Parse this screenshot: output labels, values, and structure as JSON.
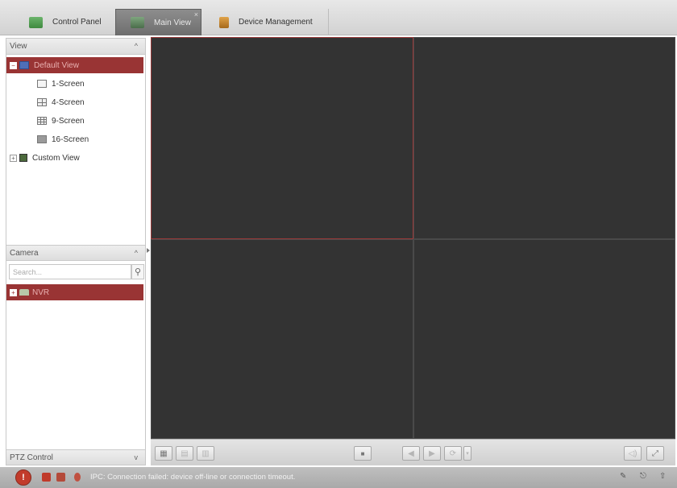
{
  "tabs": [
    {
      "label": "Control Panel",
      "active": false
    },
    {
      "label": "Main View",
      "active": true,
      "close": "×"
    },
    {
      "label": "Device Management",
      "active": false
    }
  ],
  "view_panel": {
    "header": "View",
    "collapse_glyph": "^",
    "default_view": "Default View",
    "screens": [
      "1-Screen",
      "4-Screen",
      "9-Screen",
      "16-Screen"
    ],
    "custom_view": "Custom View"
  },
  "camera_panel": {
    "header": "Camera",
    "collapse_glyph": "^",
    "search_placeholder": "Search...",
    "search_icon": "⚲",
    "nvr_label": "NVR"
  },
  "ptz_panel": {
    "header": "PTZ Control",
    "expand_glyph": "v"
  },
  "video_grid": {
    "rows": 2,
    "cols": 2,
    "active_cell": 0,
    "background_color": "#333333",
    "active_border_color": "#9a3a3a"
  },
  "statusbar": {
    "alarm_glyph": "!",
    "message": "IPC: Connection failed: device off-line or connection timeout.",
    "right_icons": [
      "✎",
      "⎋",
      "⇧"
    ]
  },
  "colors": {
    "selected_row": "#993434",
    "alarm": "#c23b2b"
  }
}
